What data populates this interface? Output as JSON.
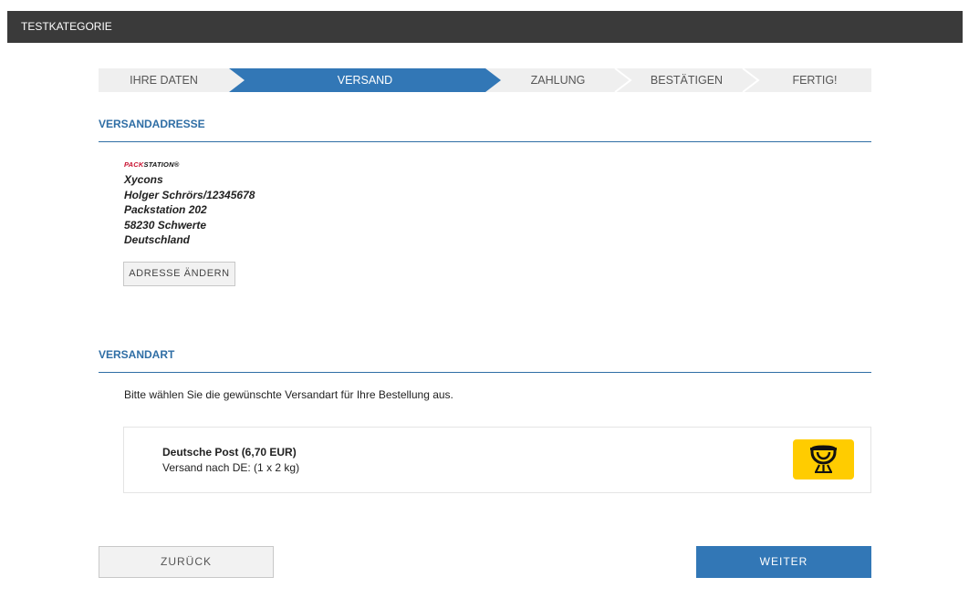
{
  "header": {
    "title": "TESTKATEGORIE"
  },
  "steps": [
    {
      "label": "IHRE DATEN",
      "active": false
    },
    {
      "label": "VERSAND",
      "active": true
    },
    {
      "label": "ZAHLUNG",
      "active": false
    },
    {
      "label": "BESTÄTIGEN",
      "active": false
    },
    {
      "label": "FERTIG!",
      "active": false
    }
  ],
  "colors": {
    "accent": "#2f6ea5",
    "step_active": "#3277b6",
    "step_inactive": "#efefef",
    "topbar": "#3a3a3a",
    "dp_yellow": "#ffcc00"
  },
  "address_section": {
    "title": "VERSANDADRESSE",
    "logo": {
      "pack": "PACK",
      "station": "STATION",
      "mark": "®"
    },
    "lines": [
      "Xycons",
      "Holger Schrörs/12345678",
      "Packstation 202",
      "58230 Schwerte",
      "Deutschland"
    ],
    "change_button": "ADRESSE ÄNDERN"
  },
  "shipping_section": {
    "title": "VERSANDART",
    "instruction": "Bitte wählen Sie die gewünschte Versandart für Ihre Bestellung aus.",
    "option": {
      "name": "Deutsche Post (6,70 EUR)",
      "description": "Versand nach DE: (1 x 2 kg)",
      "icon": "deutsche-post-horn-icon"
    }
  },
  "buttons": {
    "back": "ZURÜCK",
    "next": "WEITER"
  }
}
